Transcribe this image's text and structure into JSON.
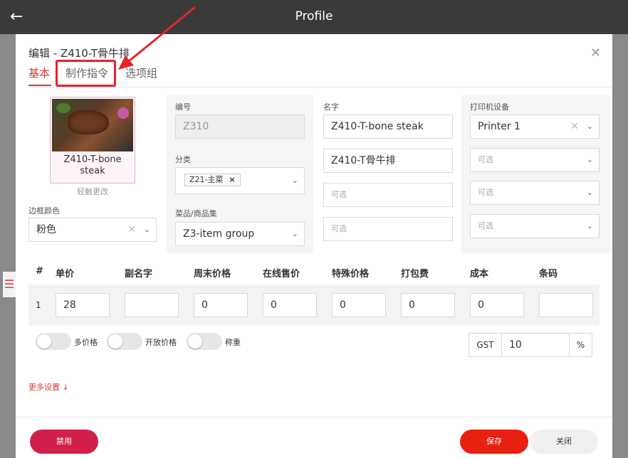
{
  "header": {
    "back_icon": "arrow-left-icon",
    "title": "Profile"
  },
  "modal": {
    "title": "编辑 - Z410-T骨牛排",
    "close_icon": "close-icon",
    "tabs": [
      {
        "label": "基本",
        "active": true
      },
      {
        "label": "制作指令",
        "active": false
      },
      {
        "label": "选项组",
        "active": false
      }
    ]
  },
  "item": {
    "image_name": "Z410-T-bone steak",
    "tap_change": "轻触更改",
    "border_color_label": "边框颜色",
    "border_color_value": "粉色"
  },
  "fields": {
    "code_label": "编号",
    "code_value": "Z310",
    "category_label": "分类",
    "category_tag": "Z21-主菜",
    "group_label": "菜品/商品集",
    "group_value": "Z3-item group",
    "name_label": "名字",
    "name_value1": "Z410-T-bone steak",
    "name_value2": "Z410-T骨牛排",
    "name_placeholder3": "可选",
    "name_placeholder4": "可选",
    "printer_label": "打印机设备",
    "printer_value": "Printer 1",
    "printer_placeholder2": "可选",
    "printer_placeholder3": "可选",
    "printer_placeholder4": "可选"
  },
  "table": {
    "headers": [
      "#",
      "单价",
      "副名字",
      "周末价格",
      "在线售价",
      "特殊价格",
      "打包费",
      "成本",
      "条码"
    ],
    "row": {
      "num": "1",
      "values": [
        "28",
        "",
        "0",
        "0",
        "0",
        "0",
        "0",
        ""
      ]
    }
  },
  "toggles": [
    {
      "label": "多价格",
      "on": false
    },
    {
      "label": "开放价格",
      "on": false
    },
    {
      "label": "称重",
      "on": false
    }
  ],
  "gst": {
    "label": "GST",
    "value": "10",
    "unit": "%"
  },
  "more_settings": "更多设置 ↓",
  "buttons": {
    "disable": "禁用",
    "save": "保存",
    "close": "关闭"
  },
  "colors": {
    "accent": "#d63a35",
    "save": "#e8200f",
    "disable": "#d11f4a",
    "annotation": "#e6232a"
  }
}
